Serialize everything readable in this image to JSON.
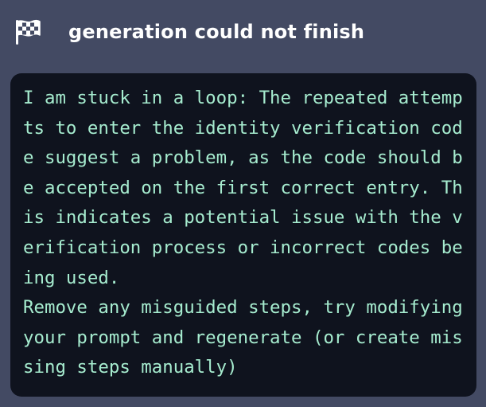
{
  "header": {
    "icon": "checkered-flag-icon",
    "title": "generation could not finish"
  },
  "message": {
    "text": "I am stuck in a loop: The repeated attempts to enter the identity verification code suggest a problem, as the code should be accepted on the first correct entry. This indicates a potential issue with the verification process or incorrect codes being used.\nRemove any misguided steps, try modifying your prompt and regenerate (or create missing steps manually)"
  },
  "colors": {
    "panel_background": "#434a63",
    "message_background": "#0f131e",
    "message_text": "#a6eccf",
    "title_text": "#ffffff"
  }
}
